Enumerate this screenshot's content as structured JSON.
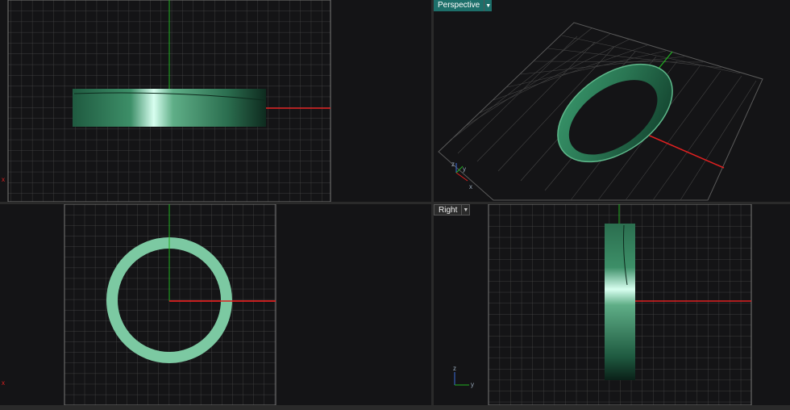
{
  "viewports": {
    "top": {
      "title": ""
    },
    "perspective": {
      "title": "Perspective"
    },
    "front": {
      "title": ""
    },
    "right": {
      "title": "Right"
    }
  },
  "axis_labels": {
    "x": "x",
    "y": "y",
    "z": "z"
  },
  "icons": {
    "dropdown": "chevron-down-icon"
  },
  "colors": {
    "viewport_bg": "#141416",
    "grid": "#5a5a5a",
    "axis_x": "#e02020",
    "axis_y": "#20b020",
    "ring": "#2e8a5e",
    "ring_flat": "#7cc9a2",
    "active_tab": "#1d6f6a"
  }
}
